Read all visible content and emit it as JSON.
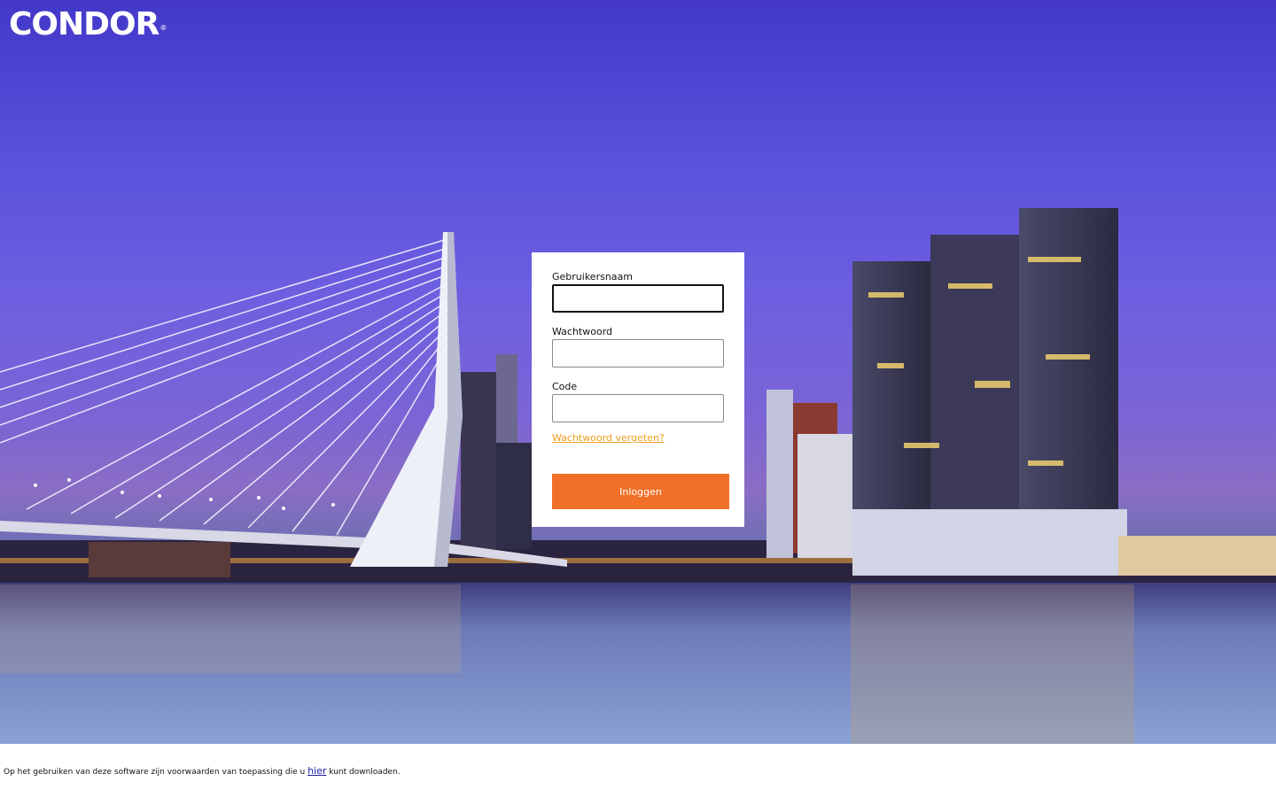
{
  "brand": {
    "logo_text": "CONDOR",
    "registered_mark": "®"
  },
  "login": {
    "username_label": "Gebruikersnaam",
    "username_value": "",
    "password_label": "Wachtwoord",
    "password_value": "",
    "code_label": "Code",
    "code_value": "",
    "forgot_password_link": "Wachtwoord vergeten?",
    "submit_label": "Inloggen"
  },
  "footer": {
    "text_before": "Op het gebruiken van deze software zijn voorwaarden van toepassing die u",
    "link_text": "hier",
    "text_after": "kunt downloaden."
  },
  "colors": {
    "accent": "#f07028",
    "link": "#f0a020",
    "footer_link": "#1a1aa6"
  }
}
